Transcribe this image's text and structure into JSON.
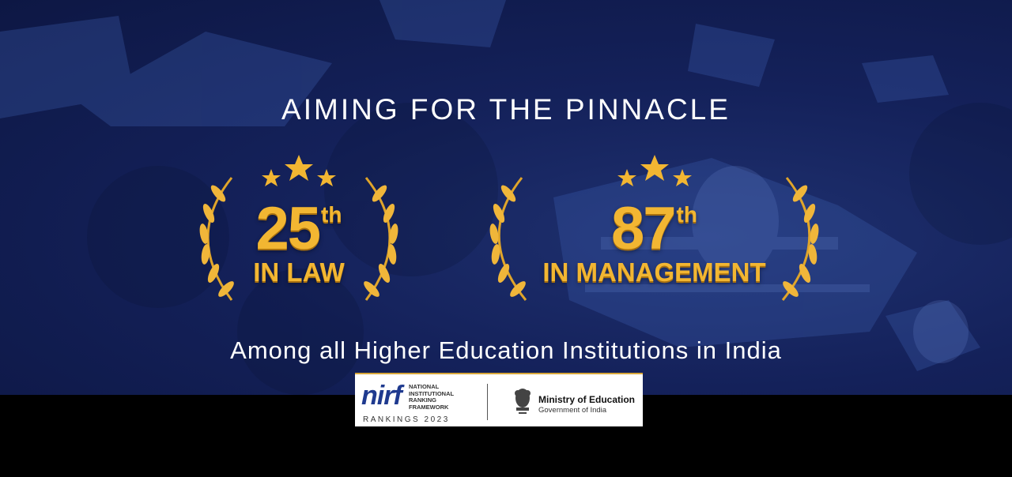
{
  "headline": "AIMING FOR THE PINNACLE",
  "awards": [
    {
      "rank_number": "25",
      "rank_suffix": "th",
      "category": "IN LAW"
    },
    {
      "rank_number": "87",
      "rank_suffix": "th",
      "category": "IN MANAGEMENT"
    }
  ],
  "tagline": "Among all Higher Education Institutions in India",
  "logo_box": {
    "nirf_wordmark": "nirf",
    "nirf_lines": [
      "NATIONAL",
      "INSTITUTIONAL",
      "RANKING",
      "FRAMEWORK"
    ],
    "rankings_label": "RANKINGS 2023",
    "ministry_title": "Ministry of Education",
    "ministry_subtitle": "Government of India"
  },
  "colors": {
    "banner_navy": "#14215a",
    "gold": "#f2b632",
    "white": "#ffffff",
    "nirf_blue": "#1f3a8f"
  }
}
